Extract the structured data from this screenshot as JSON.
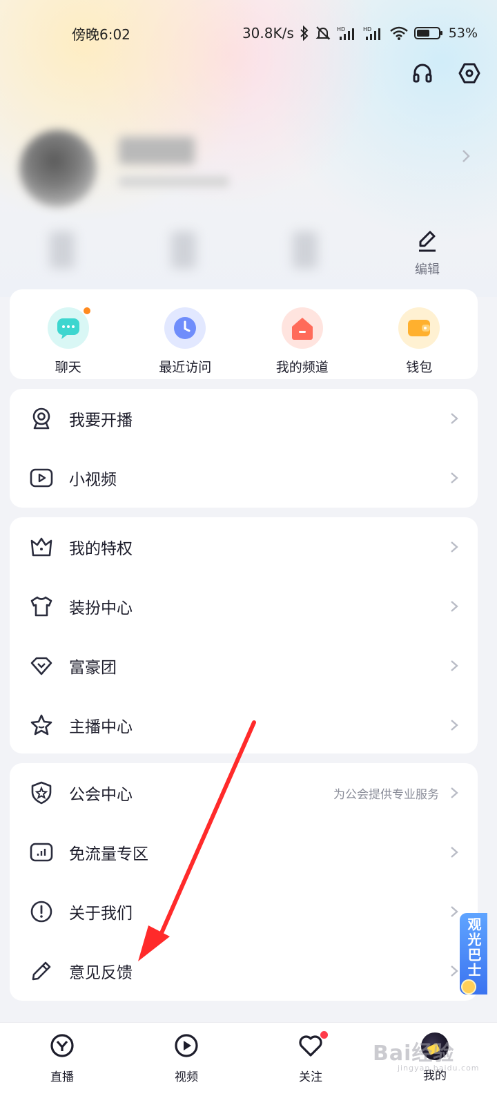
{
  "status_bar": {
    "time": "傍晚6:02",
    "net_speed": "30.8K/s",
    "battery_pct": "53%"
  },
  "top_icons": [
    "headphones-icon",
    "settings-hexagon-icon"
  ],
  "profile": {
    "edit_label": "编辑"
  },
  "quick_actions": [
    {
      "label": "聊天",
      "icon": "chat-icon",
      "color": "#3dd6cf",
      "badge": true
    },
    {
      "label": "最近访问",
      "icon": "clock-icon",
      "color": "#6f8dfb",
      "badge": false
    },
    {
      "label": "我的频道",
      "icon": "channel-house-icon",
      "color": "#ff6b5a",
      "badge": false
    },
    {
      "label": "钱包",
      "icon": "wallet-icon",
      "color": "#ffb02e",
      "badge": false
    }
  ],
  "menu_group_1": [
    {
      "label": "我要开播",
      "icon": "webcam-icon",
      "hint": ""
    },
    {
      "label": "小视频",
      "icon": "video-play-icon",
      "hint": ""
    }
  ],
  "menu_group_2": [
    {
      "label": "我的特权",
      "icon": "crown-icon",
      "hint": ""
    },
    {
      "label": "装扮中心",
      "icon": "tshirt-icon",
      "hint": ""
    },
    {
      "label": "富豪团",
      "icon": "diamond-icon",
      "hint": ""
    },
    {
      "label": "主播中心",
      "icon": "star-icon",
      "hint": ""
    }
  ],
  "menu_group_3": [
    {
      "label": "公会中心",
      "icon": "shield-star-icon",
      "hint": "为公会提供专业服务"
    },
    {
      "label": "免流量专区",
      "icon": "data-chart-icon",
      "hint": ""
    },
    {
      "label": "关于我们",
      "icon": "info-exclamation-icon",
      "hint": ""
    },
    {
      "label": "意见反馈",
      "icon": "pencil-icon",
      "hint": ""
    }
  ],
  "side_float": {
    "text": "观光巴士"
  },
  "tabbar": [
    {
      "label": "直播",
      "icon": "live-logo-icon",
      "dot": false
    },
    {
      "label": "视频",
      "icon": "play-circle-icon",
      "dot": false
    },
    {
      "label": "关注",
      "icon": "heart-icon",
      "dot": true
    },
    {
      "label": "我的",
      "icon": "user-avatar-icon",
      "dot": false
    }
  ],
  "watermark": {
    "text": "Bai经验",
    "sub": "jingyan.baidu.com"
  },
  "colors": {
    "accent_arrow": "#ff2a2a",
    "chevron": "#b9bcc6",
    "icon_stroke": "#2a2c3d"
  }
}
